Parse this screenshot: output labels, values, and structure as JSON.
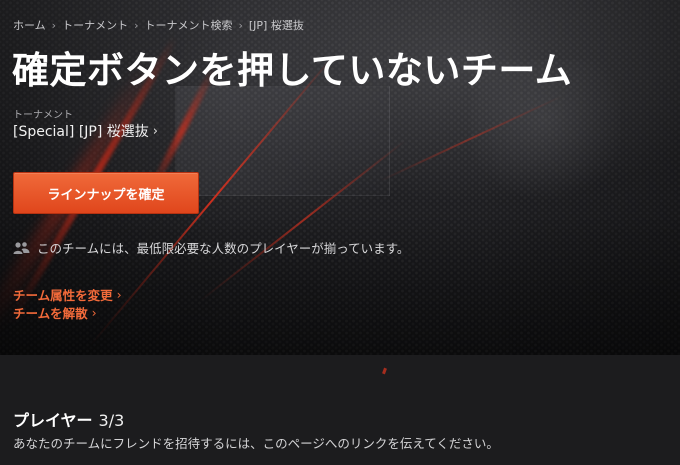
{
  "breadcrumb": {
    "items": [
      "ホーム",
      "トーナメント",
      "トーナメント検索",
      "[JP] 桜選抜"
    ]
  },
  "page": {
    "title": "確定ボタンを押していないチーム"
  },
  "tournament": {
    "label": "トーナメント",
    "name": "[Special] [JP] 桜選抜"
  },
  "actions": {
    "confirm_lineup": "ラインナップを確定",
    "change_attributes": "チーム属性を変更",
    "disband_team": "チームを解散"
  },
  "status": {
    "text": "このチームには、最低限必要な人数のプレイヤーが揃っています。"
  },
  "players": {
    "heading": "プレイヤー",
    "count": "3/3",
    "invite_text": "あなたのチームにフレンドを招待するには、このページへのリンクを伝えてください。"
  },
  "colors": {
    "accent": "#e8541f",
    "link_accent": "#f26a3a",
    "background": "#1c1c1e"
  },
  "icons": {
    "chevron": "chevron-right-icon",
    "status": "users-icon"
  }
}
